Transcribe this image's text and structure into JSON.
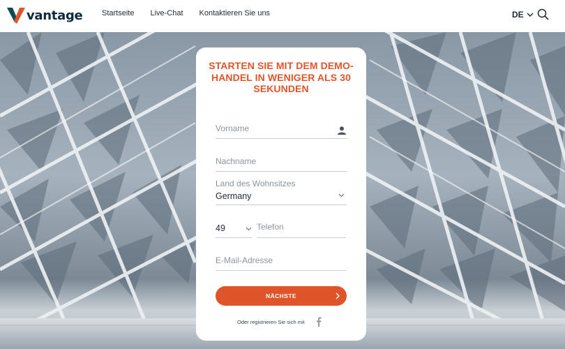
{
  "brand": {
    "name": "vantage",
    "accent": "#e0542a",
    "dark": "#0d2b3e"
  },
  "nav": {
    "items": [
      "Startseite",
      "Live-Chat",
      "Kontaktieren Sie uns"
    ]
  },
  "language": {
    "selected": "DE"
  },
  "icons": {
    "search": "search-icon",
    "user": "user-icon",
    "chevron": "chevron-down-icon",
    "facebook": "facebook-icon"
  },
  "form": {
    "title": "STARTEN SIE MIT DEM DEMO-HANDEL IN WENIGER ALS 30 SEKUNDEN",
    "first_name_placeholder": "Vorname",
    "last_name_placeholder": "Nachname",
    "country_label": "Land des Wohnsitzes",
    "country_value": "Germany",
    "phone_code": "49",
    "phone_placeholder": "Telefon",
    "email_placeholder": "E-Mail-Adresse",
    "submit_label": "NÄCHSTE",
    "social_text": "Oder registrieren Sie sich mit"
  }
}
